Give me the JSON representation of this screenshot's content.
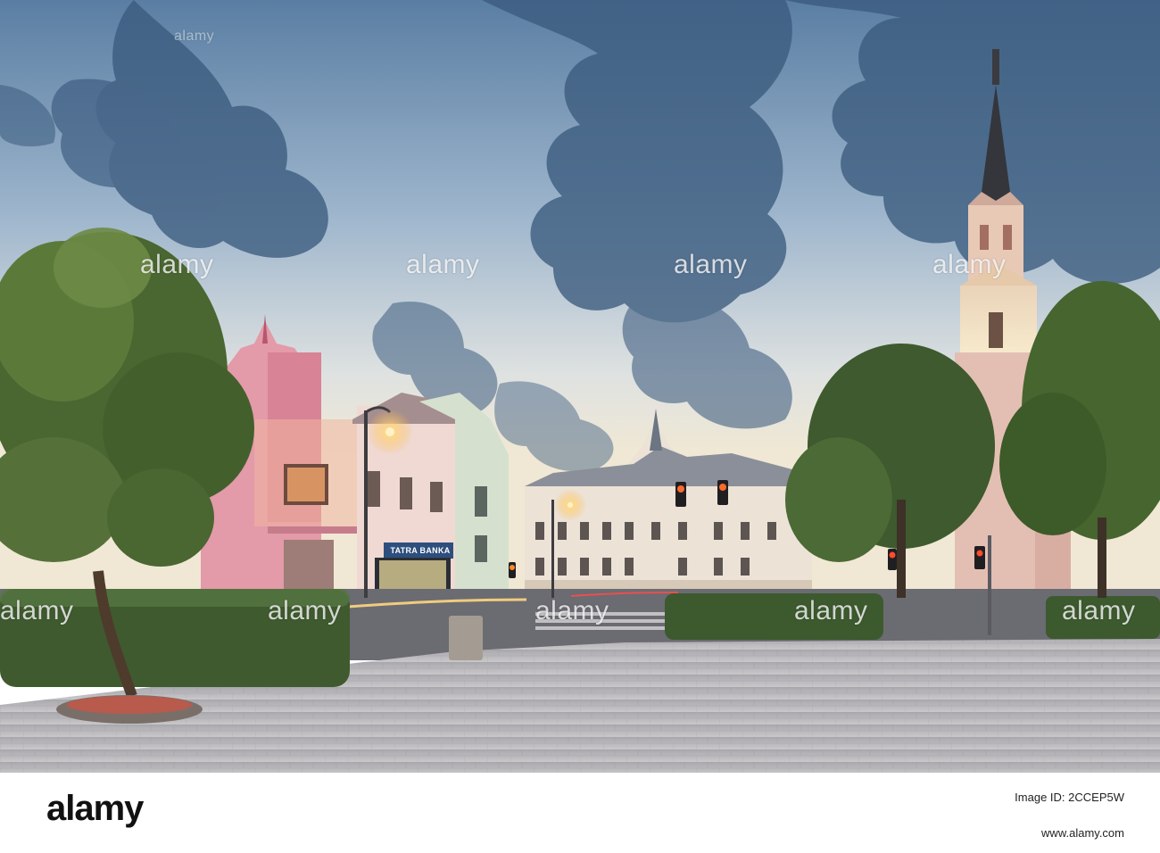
{
  "photo": {
    "shop_sign": "TATRA BANKA"
  },
  "watermark": {
    "text": "alamy",
    "repeat": [
      "alamy",
      "alamy",
      "alamy",
      "alamy",
      "alamy",
      "alamy",
      "alamy",
      "alamy",
      "alamy",
      "alamy"
    ]
  },
  "footer": {
    "logo": "alamy",
    "image_id_label": "Image ID: 2CCEP5W",
    "image_id": "2CCEP5W",
    "website": "www.alamy.com"
  },
  "colors": {
    "sky_top": "#4d6f93",
    "sky_mid": "#a9bfd2",
    "sky_glow": "#f1e9d4",
    "pink_building": "#e39aa9",
    "pavement": "#bdbcbf",
    "tree": "#4f6a32"
  }
}
